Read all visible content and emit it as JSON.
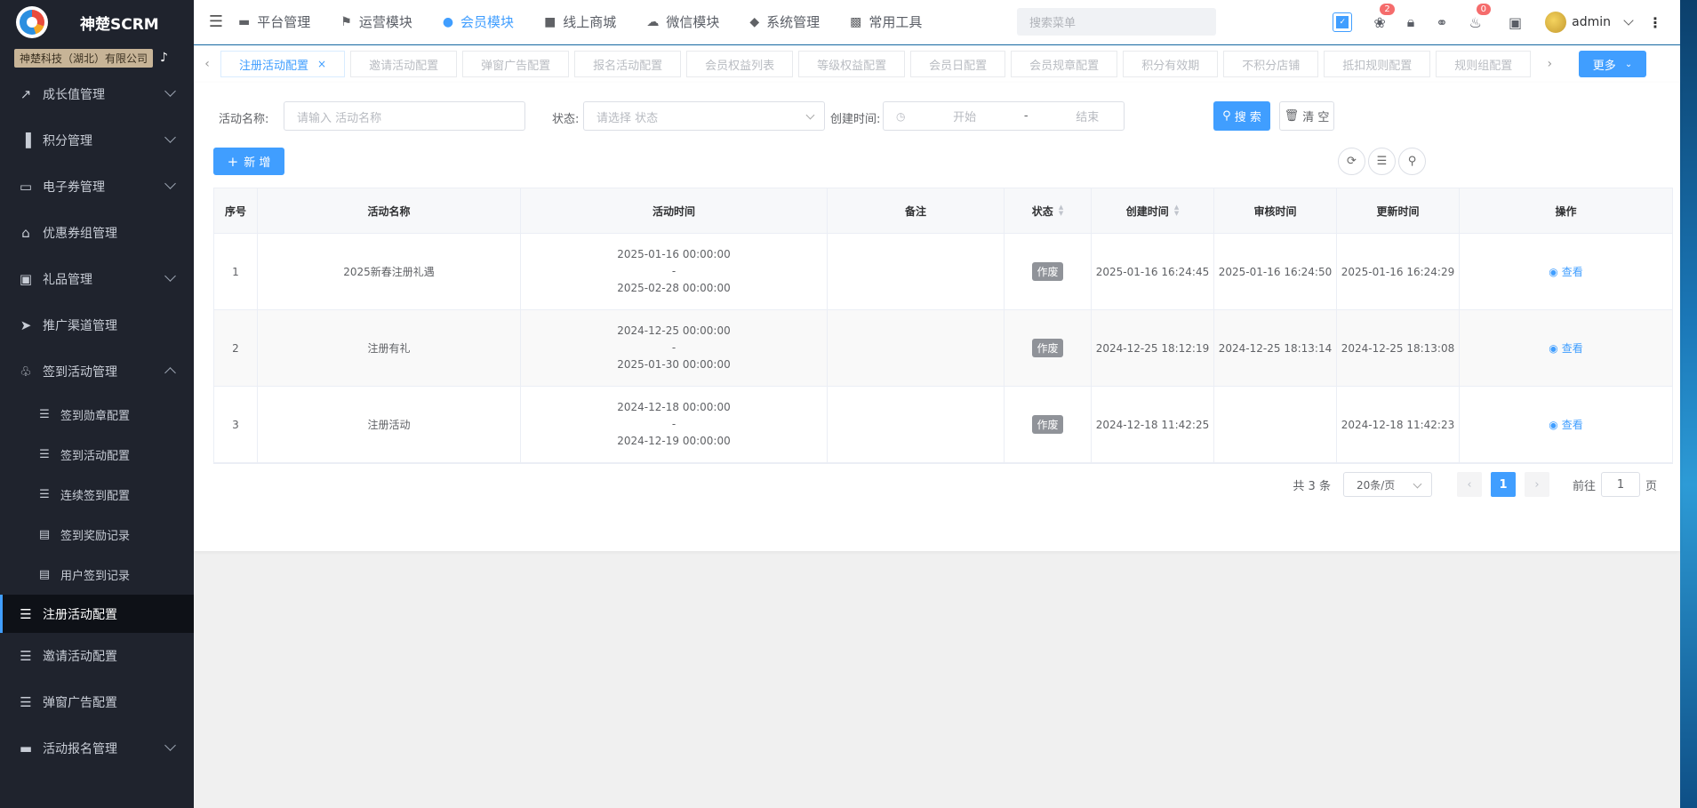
{
  "app": {
    "title": "神楚SCRM",
    "company": "神楚科技（湖北）有限公司"
  },
  "sidebar": {
    "items": [
      {
        "label": "成长值管理",
        "icon": "chart-line-icon",
        "expandable": true
      },
      {
        "label": "积分管理",
        "icon": "bar-chart-icon",
        "expandable": true
      },
      {
        "label": "电子券管理",
        "icon": "ticket-icon",
        "expandable": true
      },
      {
        "label": "优惠券组管理",
        "icon": "bank-icon",
        "expandable": false
      },
      {
        "label": "礼品管理",
        "icon": "briefcase-icon",
        "expandable": true
      },
      {
        "label": "推广渠道管理",
        "icon": "send-icon",
        "expandable": false
      },
      {
        "label": "签到活动管理",
        "icon": "bell-icon",
        "expandable": true,
        "expanded": true
      }
    ],
    "sub_items": [
      {
        "label": "签到勋章配置",
        "icon": "sliders-icon"
      },
      {
        "label": "签到活动配置",
        "icon": "sliders-icon"
      },
      {
        "label": "连续签到配置",
        "icon": "sliders-icon"
      },
      {
        "label": "签到奖励记录",
        "icon": "clipboard-icon"
      },
      {
        "label": "用户签到记录",
        "icon": "clipboard-icon"
      }
    ],
    "after_items": [
      {
        "label": "注册活动配置",
        "icon": "sliders-icon",
        "active": true
      },
      {
        "label": "邀请活动配置",
        "icon": "sliders-icon"
      },
      {
        "label": "弹窗广告配置",
        "icon": "sliders-icon"
      },
      {
        "label": "活动报名管理",
        "icon": "monitor-icon",
        "expandable": true
      }
    ]
  },
  "topnav": {
    "items": [
      {
        "label": "平台管理",
        "icon": "monitor-icon"
      },
      {
        "label": "运营模块",
        "icon": "flag-icon"
      },
      {
        "label": "会员模块",
        "icon": "user-icon",
        "active": true
      },
      {
        "label": "线上商城",
        "icon": "shop-icon"
      },
      {
        "label": "微信模块",
        "icon": "wechat-icon"
      },
      {
        "label": "系统管理",
        "icon": "shield-icon"
      },
      {
        "label": "常用工具",
        "icon": "toolbox-icon"
      }
    ],
    "search_placeholder": "搜索菜单",
    "bug_badge": "2",
    "bell_badge": "0",
    "user": "admin"
  },
  "tabs": {
    "items": [
      "注册活动配置",
      "邀请活动配置",
      "弹窗广告配置",
      "报名活动配置",
      "会员权益列表",
      "等级权益配置",
      "会员日配置",
      "会员规章配置",
      "积分有效期",
      "不积分店铺",
      "抵扣规则配置",
      "规则组配置"
    ],
    "more_label": "更多"
  },
  "filters": {
    "name_label": "活动名称:",
    "name_placeholder": "请输入 活动名称",
    "status_label": "状态:",
    "status_placeholder": "请选择 状态",
    "time_label": "创建时间:",
    "start_placeholder": "开始",
    "separator": "-",
    "end_placeholder": "结束",
    "search_button": "搜 索",
    "clear_button": "清 空",
    "add_button": "新 增"
  },
  "table": {
    "columns": [
      "序号",
      "活动名称",
      "活动时间",
      "备注",
      "状态",
      "创建时间",
      "审核时间",
      "更新时间",
      "操作"
    ],
    "rows": [
      {
        "index": "1",
        "name": "2025新春注册礼遇",
        "start": "2025-01-16 00:00:00",
        "sep": "-",
        "end": "2025-02-28 00:00:00",
        "remark": "",
        "status": "作废",
        "created": "2025-01-16 16:24:45",
        "audited": "2025-01-16 16:24:50",
        "updated": "2025-01-16 16:24:29",
        "action": "查看"
      },
      {
        "index": "2",
        "name": "注册有礼",
        "start": "2024-12-25 00:00:00",
        "sep": "-",
        "end": "2025-01-30 00:00:00",
        "remark": "",
        "status": "作废",
        "created": "2024-12-25 18:12:19",
        "audited": "2024-12-25 18:13:14",
        "updated": "2024-12-25 18:13:08",
        "action": "查看"
      },
      {
        "index": "3",
        "name": "注册活动",
        "start": "2024-12-18 00:00:00",
        "sep": "-",
        "end": "2024-12-19 00:00:00",
        "remark": "",
        "status": "作废",
        "created": "2024-12-18 11:42:25",
        "audited": "",
        "updated": "2024-12-18 11:42:23",
        "action": "查看"
      }
    ]
  },
  "pagination": {
    "total": "共 3 条",
    "page_size": "20条/页",
    "current": "1",
    "goto_label": "前往",
    "goto_value": "1",
    "page_suffix": "页"
  },
  "colors": {
    "accent": "#409eff",
    "sidebar_bg": "#1f232d",
    "status_tag": "#909399",
    "badge": "#f56c6c"
  }
}
